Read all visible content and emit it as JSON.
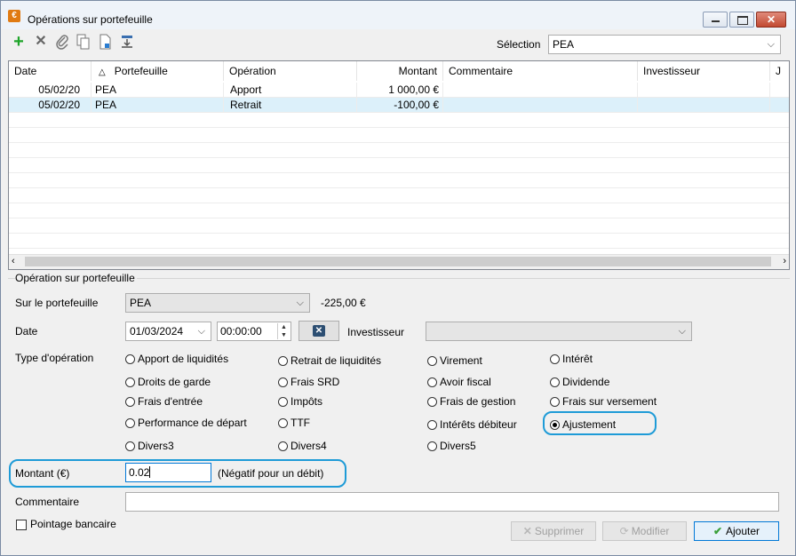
{
  "window": {
    "title": "Opérations sur portefeuille",
    "app_icon": "€"
  },
  "toolbar": {
    "icons": [
      "add-icon",
      "delete-icon",
      "attach-icon",
      "copy-icon",
      "new-document-icon",
      "import-icon"
    ],
    "selection_label": "Sélection",
    "selection_value": "PEA"
  },
  "grid": {
    "columns": [
      "Date",
      "Portefeuille",
      "Opération",
      "Montant",
      "Commentaire",
      "Investisseur",
      "J"
    ],
    "rows": [
      {
        "date": "05/02/20",
        "portefeuille": "PEA",
        "operation": "Apport",
        "montant": "1 000,00 €",
        "commentaire": "",
        "investisseur": ""
      },
      {
        "date": "05/02/20",
        "portefeuille": "PEA",
        "operation": "Retrait",
        "montant": "-100,00 €",
        "commentaire": "",
        "investisseur": ""
      }
    ]
  },
  "form": {
    "group_title": "Opération sur portefeuille",
    "portefeuille_label": "Sur le portefeuille",
    "portefeuille_value": "PEA",
    "portefeuille_balance": "-225,00 €",
    "date_label": "Date",
    "date_value": "01/03/2024",
    "time_value": "00:00:00",
    "investisseur_label": "Investisseur",
    "investisseur_value": "",
    "type_label": "Type d'opération",
    "types": [
      "Apport de liquidités",
      "Retrait de liquidités",
      "Virement",
      "Intérêt",
      "Droits de garde",
      "Frais SRD",
      "Avoir fiscal",
      "Dividende",
      "Frais d'entrée",
      "Impôts",
      "Frais de gestion",
      "Frais sur versement",
      "Performance de départ",
      "TTF",
      "Intérêts débiteur",
      "Ajustement",
      "Divers3",
      "Divers4",
      "Divers5"
    ],
    "selected_type": "Ajustement",
    "montant_label": "Montant (€)",
    "montant_value": "0.02",
    "montant_hint": "(Négatif pour un débit)",
    "commentaire_label": "Commentaire",
    "commentaire_value": "",
    "pointage_label": "Pointage bancaire",
    "pointage_checked": false
  },
  "buttons": {
    "supprimer": "Supprimer",
    "modifier": "Modifier",
    "ajouter": "Ajouter"
  }
}
